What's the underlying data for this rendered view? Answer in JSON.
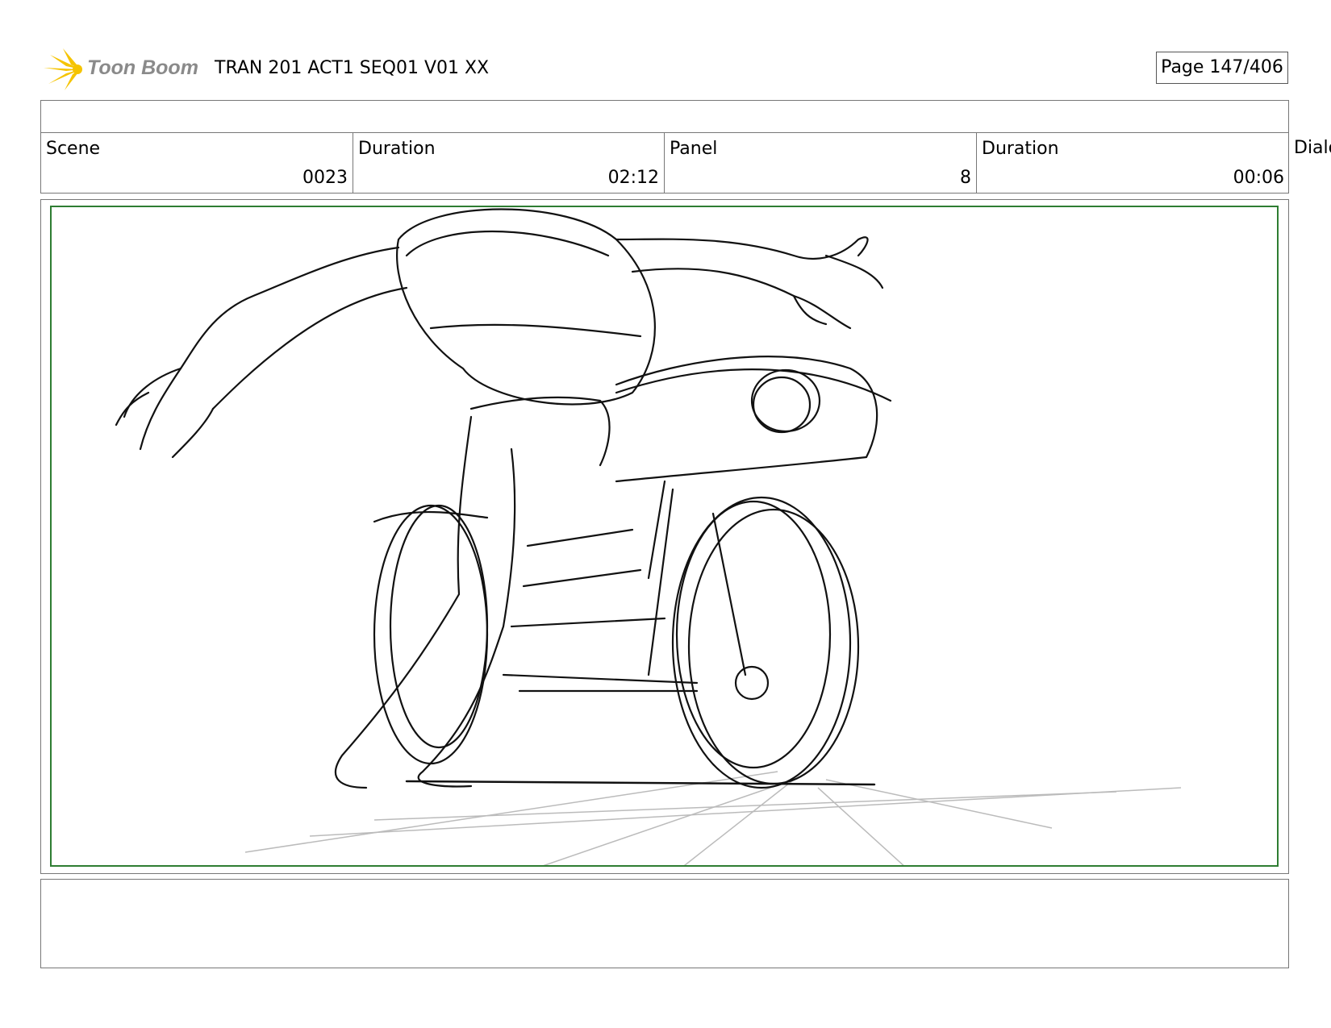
{
  "header": {
    "logo_text": "Toon Boom",
    "project_title": "TRAN 201 ACT1 SEQ01 V01 XX",
    "page_label": "Page 147/406"
  },
  "fields": [
    {
      "label": "Scene",
      "value": "0023"
    },
    {
      "label": "Duration",
      "value": "02:12"
    },
    {
      "label": "Panel",
      "value": "8"
    },
    {
      "label": "Duration",
      "value": "00:06"
    }
  ],
  "dialog_label": "Dialog",
  "colors": {
    "frame_green": "#2e7d32",
    "logo_yellow": "#f5c400",
    "logo_gray": "#8a8a8a"
  }
}
